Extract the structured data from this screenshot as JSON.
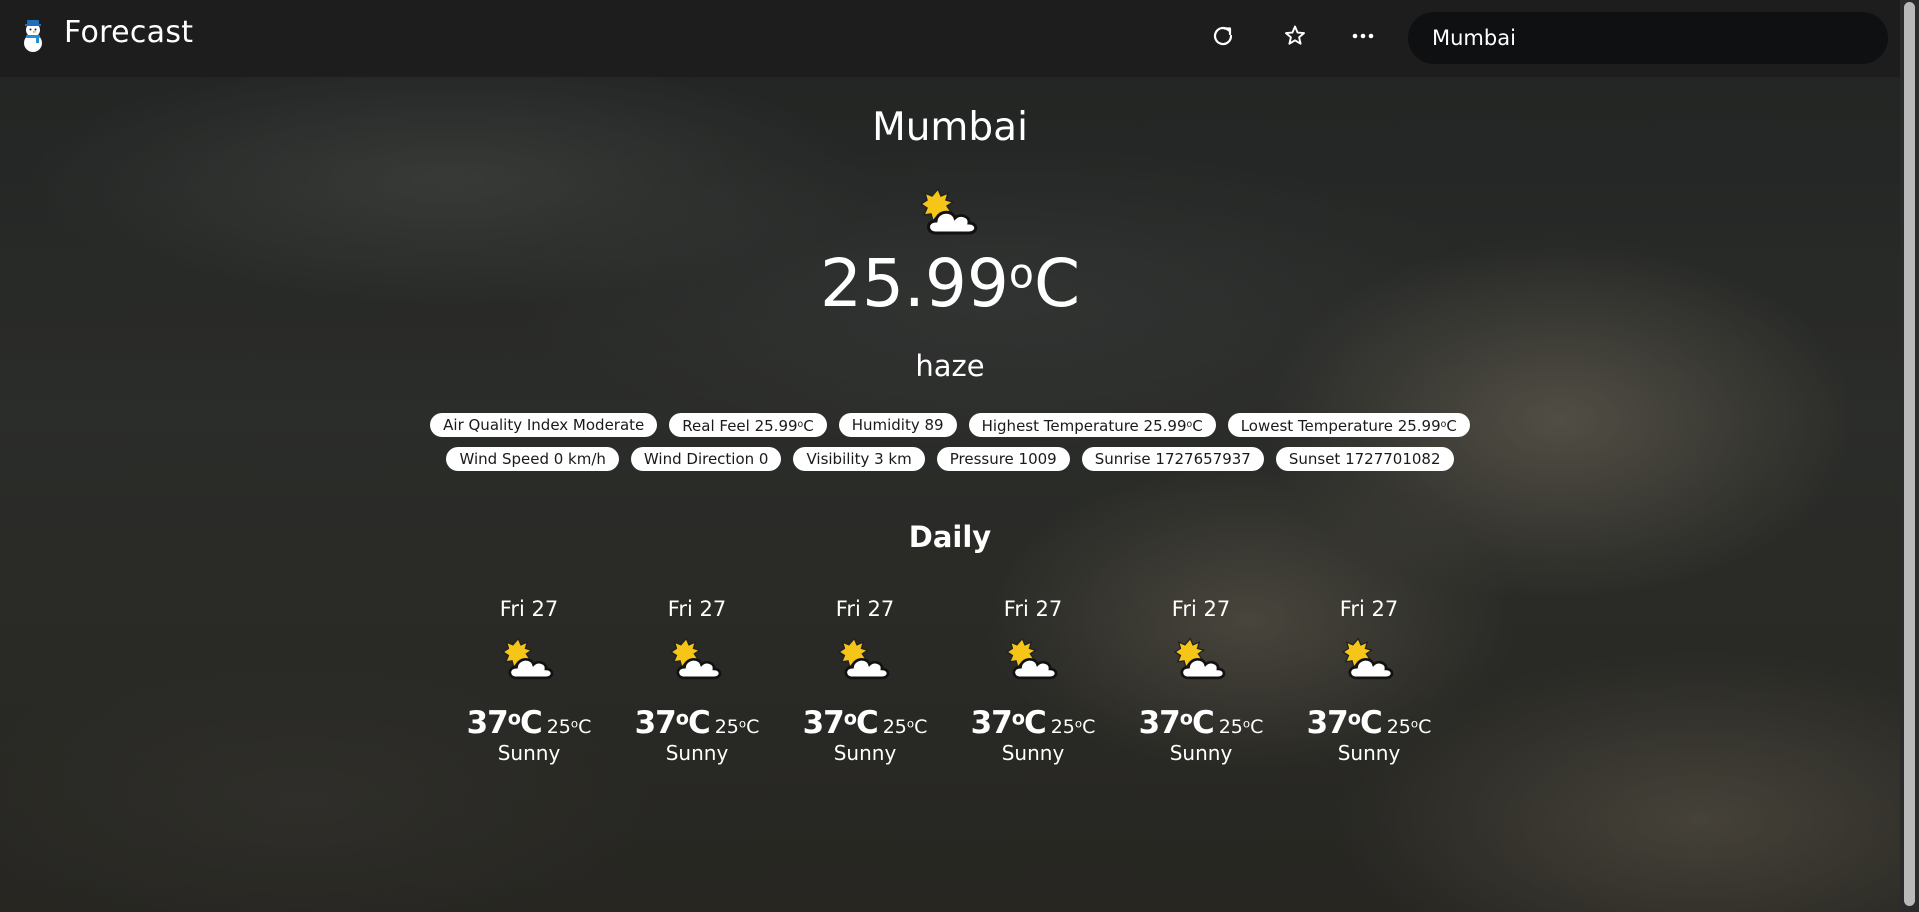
{
  "app": {
    "title": "Forecast"
  },
  "toolbar": {
    "refresh_icon": "refresh-icon",
    "favorite_icon": "star-icon",
    "more_icon": "more-horizontal-icon"
  },
  "search": {
    "value": "Mumbai",
    "placeholder": ""
  },
  "current": {
    "city": "Mumbai",
    "icon": "partly-sunny-icon",
    "temperature": "25.99",
    "unit_o": "o",
    "unit_c": "C",
    "description": "haze"
  },
  "details": {
    "row1": [
      {
        "label": "Air Quality Index Moderate"
      },
      {
        "label": "Real Feel 25.99",
        "deg": true
      },
      {
        "label": "Humidity 89"
      },
      {
        "label": "Highest Temperature 25.99",
        "deg": true
      },
      {
        "label": "Lowest Temperature 25.99",
        "deg": true
      }
    ],
    "row2": [
      {
        "label": "Wind Speed 0 km/h"
      },
      {
        "label": "Wind Direction 0"
      },
      {
        "label": "Visibility 3 km"
      },
      {
        "label": "Pressure 1009"
      },
      {
        "label": "Sunrise 1727657937"
      },
      {
        "label": "Sunset 1727701082"
      }
    ]
  },
  "daily": {
    "title": "Daily",
    "days": [
      {
        "name": "Fri 27",
        "high": "37",
        "low": "25",
        "condition": "Sunny"
      },
      {
        "name": "Fri 27",
        "high": "37",
        "low": "25",
        "condition": "Sunny"
      },
      {
        "name": "Fri 27",
        "high": "37",
        "low": "25",
        "condition": "Sunny"
      },
      {
        "name": "Fri 27",
        "high": "37",
        "low": "25",
        "condition": "Sunny"
      },
      {
        "name": "Fri 27",
        "high": "37",
        "low": "25",
        "condition": "Sunny"
      },
      {
        "name": "Fri 27",
        "high": "37",
        "low": "25",
        "condition": "Sunny"
      }
    ]
  },
  "colors": {
    "topbar": "#1c1c1c",
    "search_bg": "#0f1011",
    "chip_bg": "#ffffff",
    "sun": "#f5c518",
    "text": "#ffffff"
  }
}
